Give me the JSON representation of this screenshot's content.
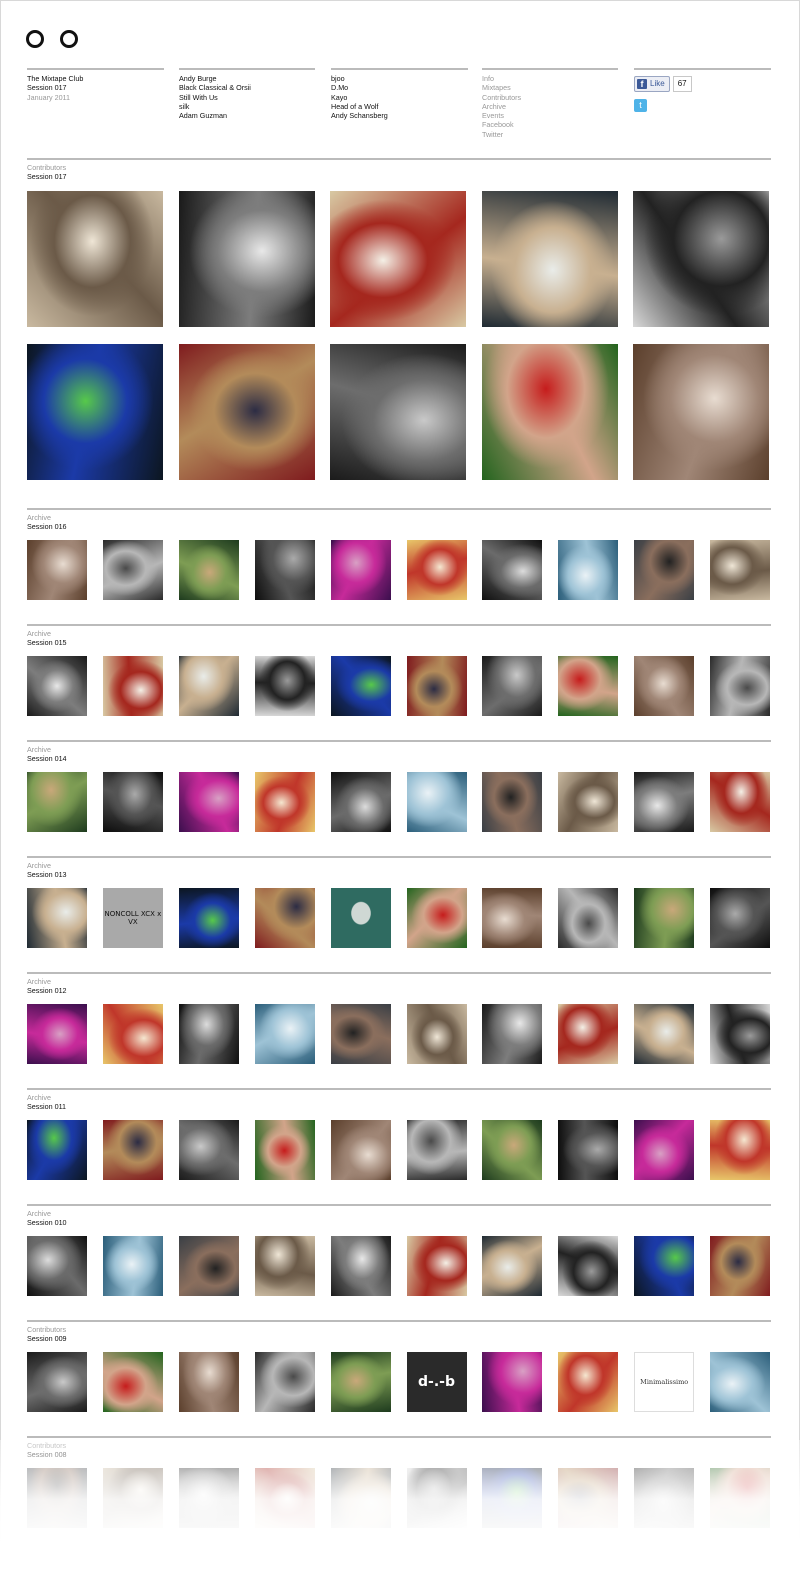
{
  "club": {
    "title": "The Mixtape Club",
    "session": "Session 017",
    "date": "January 2011"
  },
  "artists_col1": [
    "Andy Burge",
    "Black Classical & Orsii",
    "Still With Us",
    "silk",
    "Adam Guzman"
  ],
  "artists_col2": [
    "bjoo",
    "D.Mo",
    "Kayo",
    "Head of a Wolf",
    "Andy Schansberg"
  ],
  "nav": [
    "Info",
    "Mixtapes",
    "Contributors",
    "Archive",
    "Events",
    "Facebook",
    "Twitter"
  ],
  "social": {
    "like_label": "Like",
    "like_count": "67",
    "fb_icon": "facebook-icon",
    "twitter_icon": "twitter-icon"
  },
  "sections": [
    {
      "label": "Contributors",
      "session": "Session 017"
    },
    {
      "label": "Archive",
      "session": "Session 016"
    },
    {
      "label": "Archive",
      "session": "Session 015"
    },
    {
      "label": "Archive",
      "session": "Session 014"
    },
    {
      "label": "Archive",
      "session": "Session 013"
    },
    {
      "label": "Archive",
      "session": "Session 012"
    },
    {
      "label": "Archive",
      "session": "Session 011"
    },
    {
      "label": "Archive",
      "session": "Session 010"
    },
    {
      "label": "Contributors",
      "session": "Session 009"
    },
    {
      "label": "Contributors",
      "session": "Session 008"
    }
  ],
  "tile_texts": {
    "noncoll": "NONCOLL XCX x VX",
    "dmo": "d-.-b",
    "minimal": "Minimalissimo"
  },
  "colors": {
    "rule": "#bbbbbb",
    "muted": "#999999",
    "facebook": "#3b5998",
    "twitter": "#4fb3e8"
  }
}
